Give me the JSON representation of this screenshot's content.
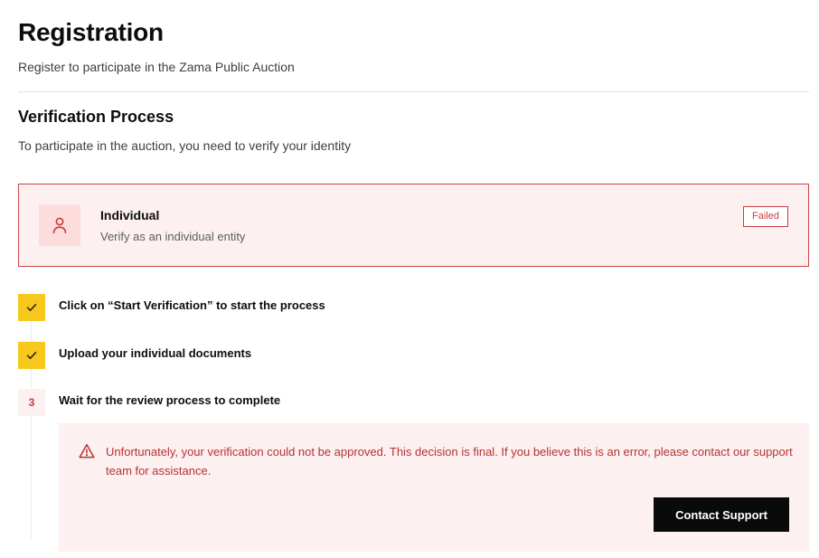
{
  "header": {
    "title": "Registration",
    "subtitle": "Register to participate in the Zama Public Auction"
  },
  "verification": {
    "title": "Verification Process",
    "description": "To participate in the auction, you need to verify your identity",
    "entity": {
      "icon": "user-icon",
      "name": "Individual",
      "description": "Verify as an individual entity",
      "status": "Failed"
    },
    "steps": [
      {
        "marker": "check-icon",
        "label": "Click on “Start Verification” to start the process"
      },
      {
        "marker": "check-icon",
        "label": "Upload your individual documents"
      },
      {
        "marker": "3",
        "label": "Wait for the review process to complete"
      }
    ],
    "alert": {
      "icon": "warning-icon",
      "message": "Unfortunately, your verification could not be approved. This decision is final. If you believe this is an error, please contact our support team for assistance.",
      "button_label": "Contact Support"
    }
  },
  "colors": {
    "accent_yellow": "#f7c91c",
    "error_red": "#cc3b3b",
    "error_bg": "#fdf0f0",
    "button_bg": "#0a0a0a"
  }
}
